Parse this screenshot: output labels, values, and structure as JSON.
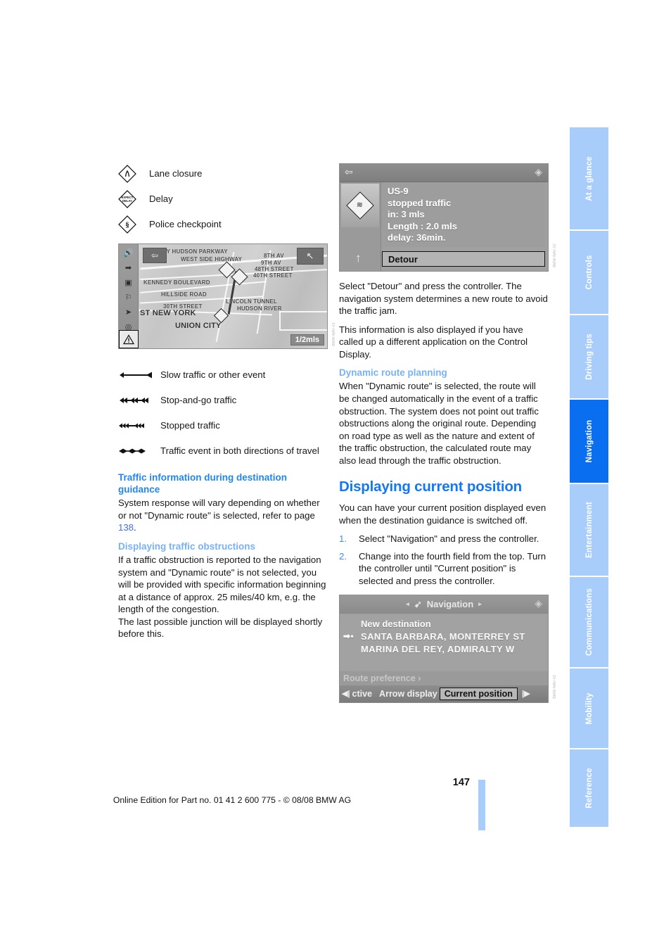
{
  "document": {
    "page_number": "147",
    "edition_line": "Online Edition for Part no. 01 41 2 600 775 - © 08/08 BMW AG"
  },
  "side_tabs": [
    {
      "label": "At a glance",
      "active": false
    },
    {
      "label": "Controls",
      "active": false
    },
    {
      "label": "Driving tips",
      "active": false
    },
    {
      "label": "Navigation",
      "active": true
    },
    {
      "label": "Entertainment",
      "active": false
    },
    {
      "label": "Communications",
      "active": false
    },
    {
      "label": "Mobility",
      "active": false
    },
    {
      "label": "Reference",
      "active": false
    }
  ],
  "left_column": {
    "symbol_legend": [
      {
        "icon": "lane-closure-diamond-icon",
        "label": "Lane closure"
      },
      {
        "icon": "expect-delay-diamond-icon",
        "label": "Delay"
      },
      {
        "icon": "police-checkpoint-diamond-icon",
        "label": "Police checkpoint"
      }
    ],
    "map_screenshot": {
      "back_icon": "back-arrow-icon",
      "compass_icon": "compass-arrow-icon",
      "scale_label": "1/2mls",
      "sidebar_icons": [
        "speaker-icon",
        "arrow-route-icon",
        "split-screen-icon",
        "pedestrian-icon",
        "north-arrow-icon",
        "compass-dial-icon"
      ],
      "warning_icon": "warning-triangle-icon",
      "map_labels": [
        "RY HUDSON PARKWAY",
        "WEST SIDE HIGHWAY",
        "8TH AV",
        "9TH AV",
        "48TH STREET",
        "40TH STREET",
        "KENNEDY BOULEVARD",
        "HILLSIDE ROAD",
        "30TH STREET",
        "LINCOLN TUNNEL",
        "HUDSON RIVER",
        "ST NEW YORK",
        "UNION CITY"
      ]
    },
    "traffic_arrow_legend": [
      {
        "icon": "slow-traffic-arrow-icon",
        "label": "Slow traffic or other event"
      },
      {
        "icon": "stop-and-go-arrow-icon",
        "label": "Stop-and-go traffic"
      },
      {
        "icon": "stopped-traffic-arrow-icon",
        "label": "Stopped traffic"
      },
      {
        "icon": "both-directions-arrow-icon",
        "label": "Traffic event in both directions of travel"
      }
    ],
    "section_traffic_info": {
      "heading": "Traffic information during destination guidance",
      "body_pre": "System response will vary depending on whether or not \"Dynamic route\" is selected, refer to page ",
      "page_ref": "138",
      "body_post": "."
    },
    "section_obstructions": {
      "heading": "Displaying traffic obstructions",
      "paragraph_1": "If a traffic obstruction is reported to the navigation system and \"Dynamic route\" is not selected, you will be provided with specific information beginning at a distance of approx. 25 miles/40 km, e.g. the length of the congestion.",
      "paragraph_2": "The last possible junction will be displayed shortly before this."
    }
  },
  "right_column": {
    "traffic_screenshot": {
      "back_icon": "back-arrow-icon",
      "corner_icon": "status-corner-icon",
      "obstruction_icon": "traffic-jam-diamond-icon",
      "up_arrow_icon": "up-arrow-icon",
      "lines": [
        "US-9",
        "stopped traffic",
        "in: 3 mls",
        "Length : 2.0 mls",
        "delay: 36min."
      ],
      "detour_button": "Detour"
    },
    "paragraph_1": "Select \"Detour\" and press the controller. The navigation system determines a new route to avoid the traffic jam.",
    "paragraph_2": "This information is also displayed if you have called up a different application on the Control Display.",
    "section_dynamic_route": {
      "heading": "Dynamic route planning",
      "paragraph": "When \"Dynamic route\" is selected, the route will be changed automatically in the event of a traffic obstruction. The system does not point out traffic obstructions along the original route. Depending on road type as well as the nature and extent of the traffic obstruction, the calculated route may also lead through the traffic obstruction."
    },
    "section_current_position": {
      "heading": "Displaying current position",
      "intro": "You can have your current position displayed even when the destination guidance is switched off.",
      "steps": [
        {
          "num": "1.",
          "text": "Select \"Navigation\" and press the controller."
        },
        {
          "num": "2.",
          "text": "Change into the fourth field from the top. Turn the controller until \"Current position\" is selected and press the controller."
        }
      ]
    },
    "nav_menu_screenshot": {
      "title": "Navigation",
      "title_icon": "navigation-arrow-icon",
      "left_chevron": "◂",
      "right_chevron": "▸",
      "corner_icon": "status-corner-icon",
      "items": [
        "New destination",
        "SANTA BARBARA, MONTERREY ST",
        "MARINA DEL REY, ADMIRALTY W"
      ],
      "destination_marker_icon": "destination-marker-icon",
      "route_preference": "Route preference ›",
      "bottom_bar": {
        "left_arrow_icon": "left-scroll-icon",
        "right_arrow_icon": "right-scroll-icon",
        "items": [
          "ctive",
          "Arrow display"
        ],
        "selected": "Current position"
      }
    }
  },
  "colors": {
    "heading_primary": "#1278f3",
    "heading_secondary": "#2186f5",
    "heading_tertiary": "#77b2f7",
    "tab_inactive": "#a8cdfa",
    "tab_active": "#0a6ef0",
    "page_ref": "#3f6ef0"
  }
}
